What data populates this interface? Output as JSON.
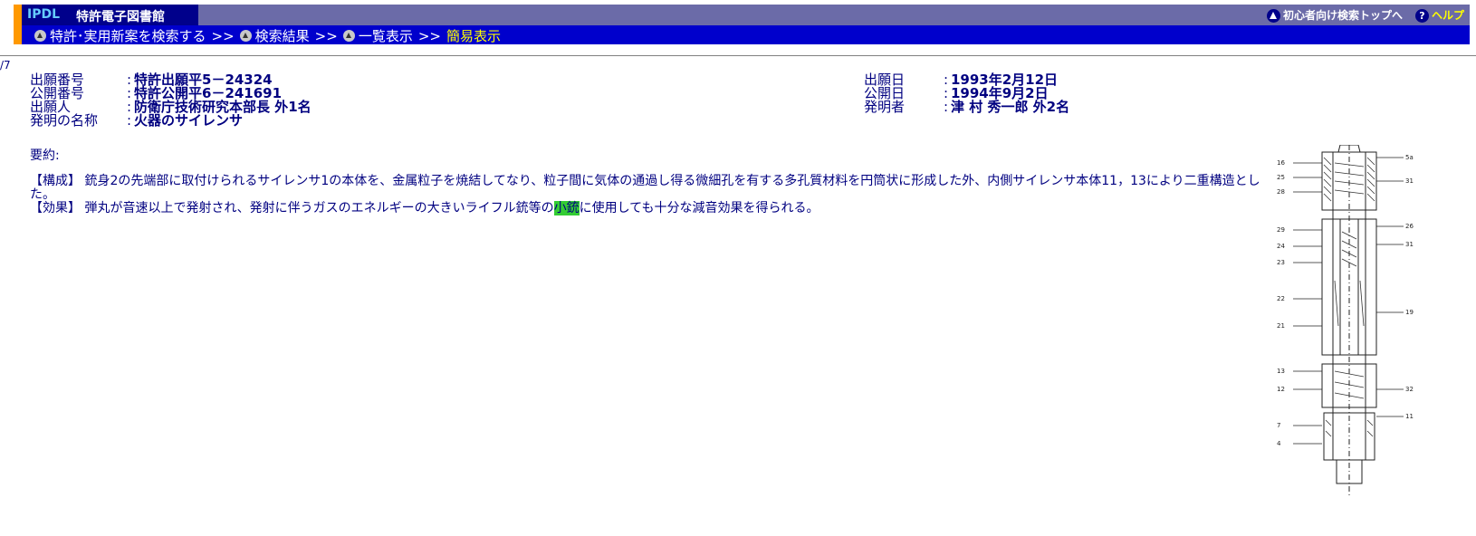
{
  "header": {
    "logo_ipdl": "IPDL",
    "logo_title": "特許電子図書館",
    "beginner_link": "初心者向け検索トップへ",
    "help_link": "ヘルプ",
    "help_icon_char": "?",
    "breadcrumb": [
      {
        "label": "特許･実用新案を検索する"
      },
      {
        "label": "検索結果"
      },
      {
        "label": "一覧表示"
      }
    ],
    "separator": ">>",
    "current": "簡易表示"
  },
  "counter": "/7",
  "fields_left": [
    {
      "label": "出願番号",
      "colon": ":",
      "value": "特許出願平5－24324"
    },
    {
      "label": "公開番号",
      "colon": ":",
      "value": "特許公開平6－241691"
    },
    {
      "label": "出願人",
      "colon": ":",
      "value": "防衛庁技術研究本部長 外1名"
    },
    {
      "label": "発明の名称",
      "colon": ":",
      "value": "火器のサイレンサ"
    }
  ],
  "fields_right": [
    {
      "label": "出願日",
      "colon": ":",
      "value": "1993年2月12日"
    },
    {
      "label": "公開日",
      "colon": ":",
      "value": "1994年9月2日"
    },
    {
      "label": "発明者",
      "colon": ":",
      "value": "津 村 秀一郎 外2名"
    }
  ],
  "abstract": {
    "label": "要約:",
    "line1": "【構成】 銃身2の先端部に取付けられるサイレンサ1の本体を、金属粒子を焼結してなり、粒子間に気体の通過し得る微細孔を有する多孔質材料を円筒状に形成した外、内側サイレンサ本体11，13により二重構造とした。",
    "line2_before": "【効果】 弾丸が音速以上で発射され、発射に伴うガスのエネルギーの大きいライフル銃等の",
    "line2_highlight": "小銃",
    "line2_after": "に使用しても十分な減音効果を得られる。"
  },
  "colors": {
    "logo_bg": "#00008b",
    "top_bar": "#6b6ba8",
    "nav_bar": "#0000cc",
    "accent_orange": "#ff9900",
    "text_navy": "#000080",
    "highlight": "#33cc33",
    "current_crumb": "#ffff00"
  },
  "icons": [
    "triangle-up-icon",
    "help-icon",
    "crumb-arrow-icon",
    "patent-drawing"
  ]
}
